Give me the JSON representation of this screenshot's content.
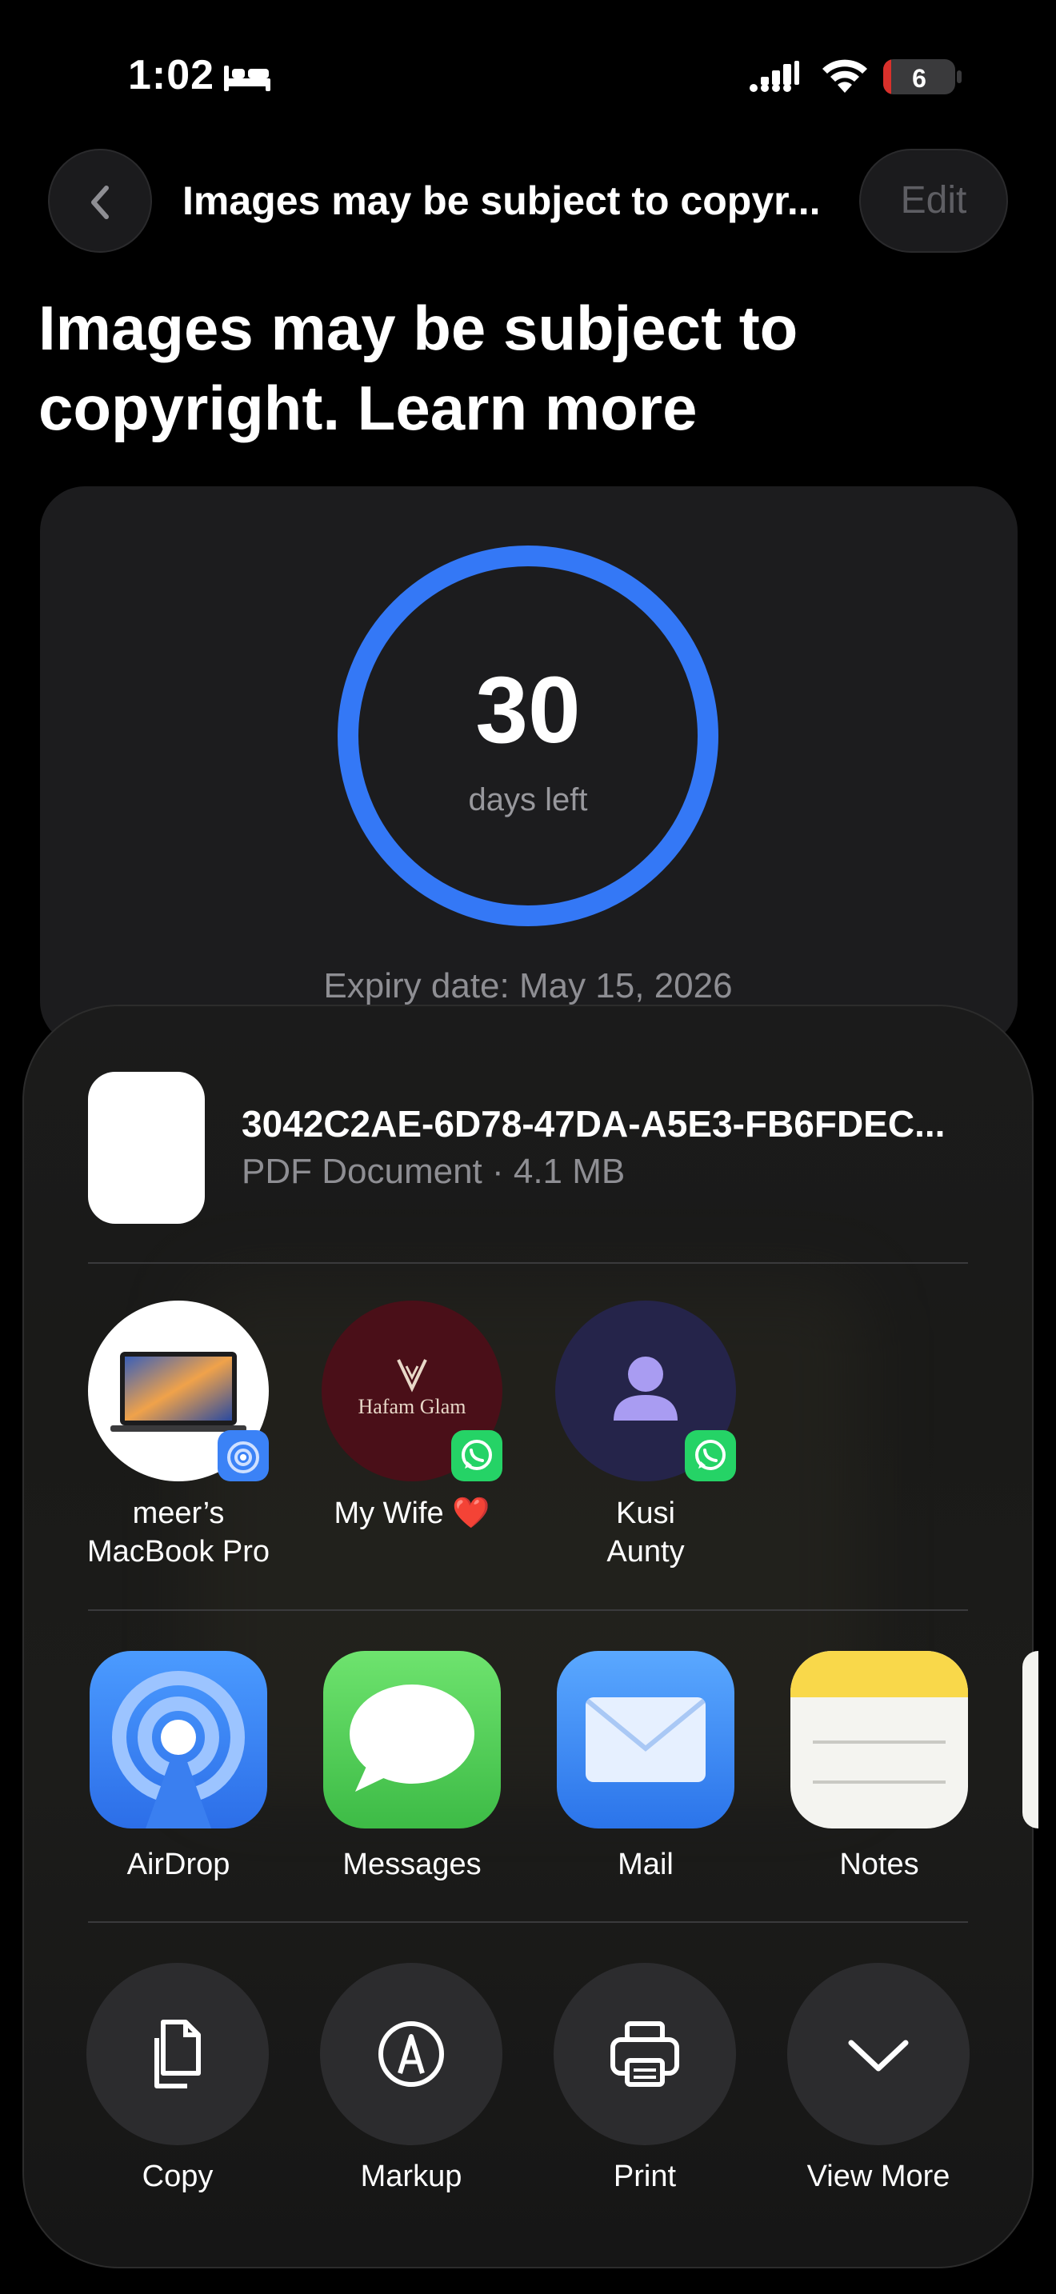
{
  "status_bar": {
    "time": "1:02",
    "battery_level": "6",
    "focus_icon": "bed-icon",
    "signal_icon": "cellular-signal-icon",
    "wifi_icon": "wifi-icon"
  },
  "nav": {
    "back_icon": "chevron-left-icon",
    "title": "Images may be subject to copyr...",
    "edit_label": "Edit"
  },
  "page_title": "Images may be subject to copyright. Learn more",
  "expiry": {
    "days_number": "30",
    "days_label": "days left",
    "expiry_date": "Expiry date: May 15, 2026",
    "ring_color": "#3478f6"
  },
  "share_sheet": {
    "file": {
      "name": "3042C2AE-6D78-47DA-A5E3-FB6FDEC...",
      "meta": "PDF Document · 4.1 MB"
    },
    "people": [
      {
        "name_line1": "meer’s",
        "name_line2": "MacBook Pro",
        "badge": "airdrop-badge-icon"
      },
      {
        "name_line1": "My Wife ❤️",
        "name_line2": "",
        "badge": "whatsapp-badge-icon",
        "avatar_text": "Hafam Glam"
      },
      {
        "name_line1": "Kusi",
        "name_line2": "Aunty",
        "badge": "whatsapp-badge-icon"
      }
    ],
    "apps": [
      {
        "label": "AirDrop",
        "icon": "airdrop-icon"
      },
      {
        "label": "Messages",
        "icon": "messages-icon"
      },
      {
        "label": "Mail",
        "icon": "mail-icon"
      },
      {
        "label": "Notes",
        "icon": "notes-icon"
      }
    ],
    "actions": [
      {
        "label": "Copy",
        "icon": "copy-icon"
      },
      {
        "label": "Markup",
        "icon": "markup-icon"
      },
      {
        "label": "Print",
        "icon": "printer-icon"
      },
      {
        "label": "View More",
        "icon": "chevron-down-icon"
      }
    ]
  }
}
